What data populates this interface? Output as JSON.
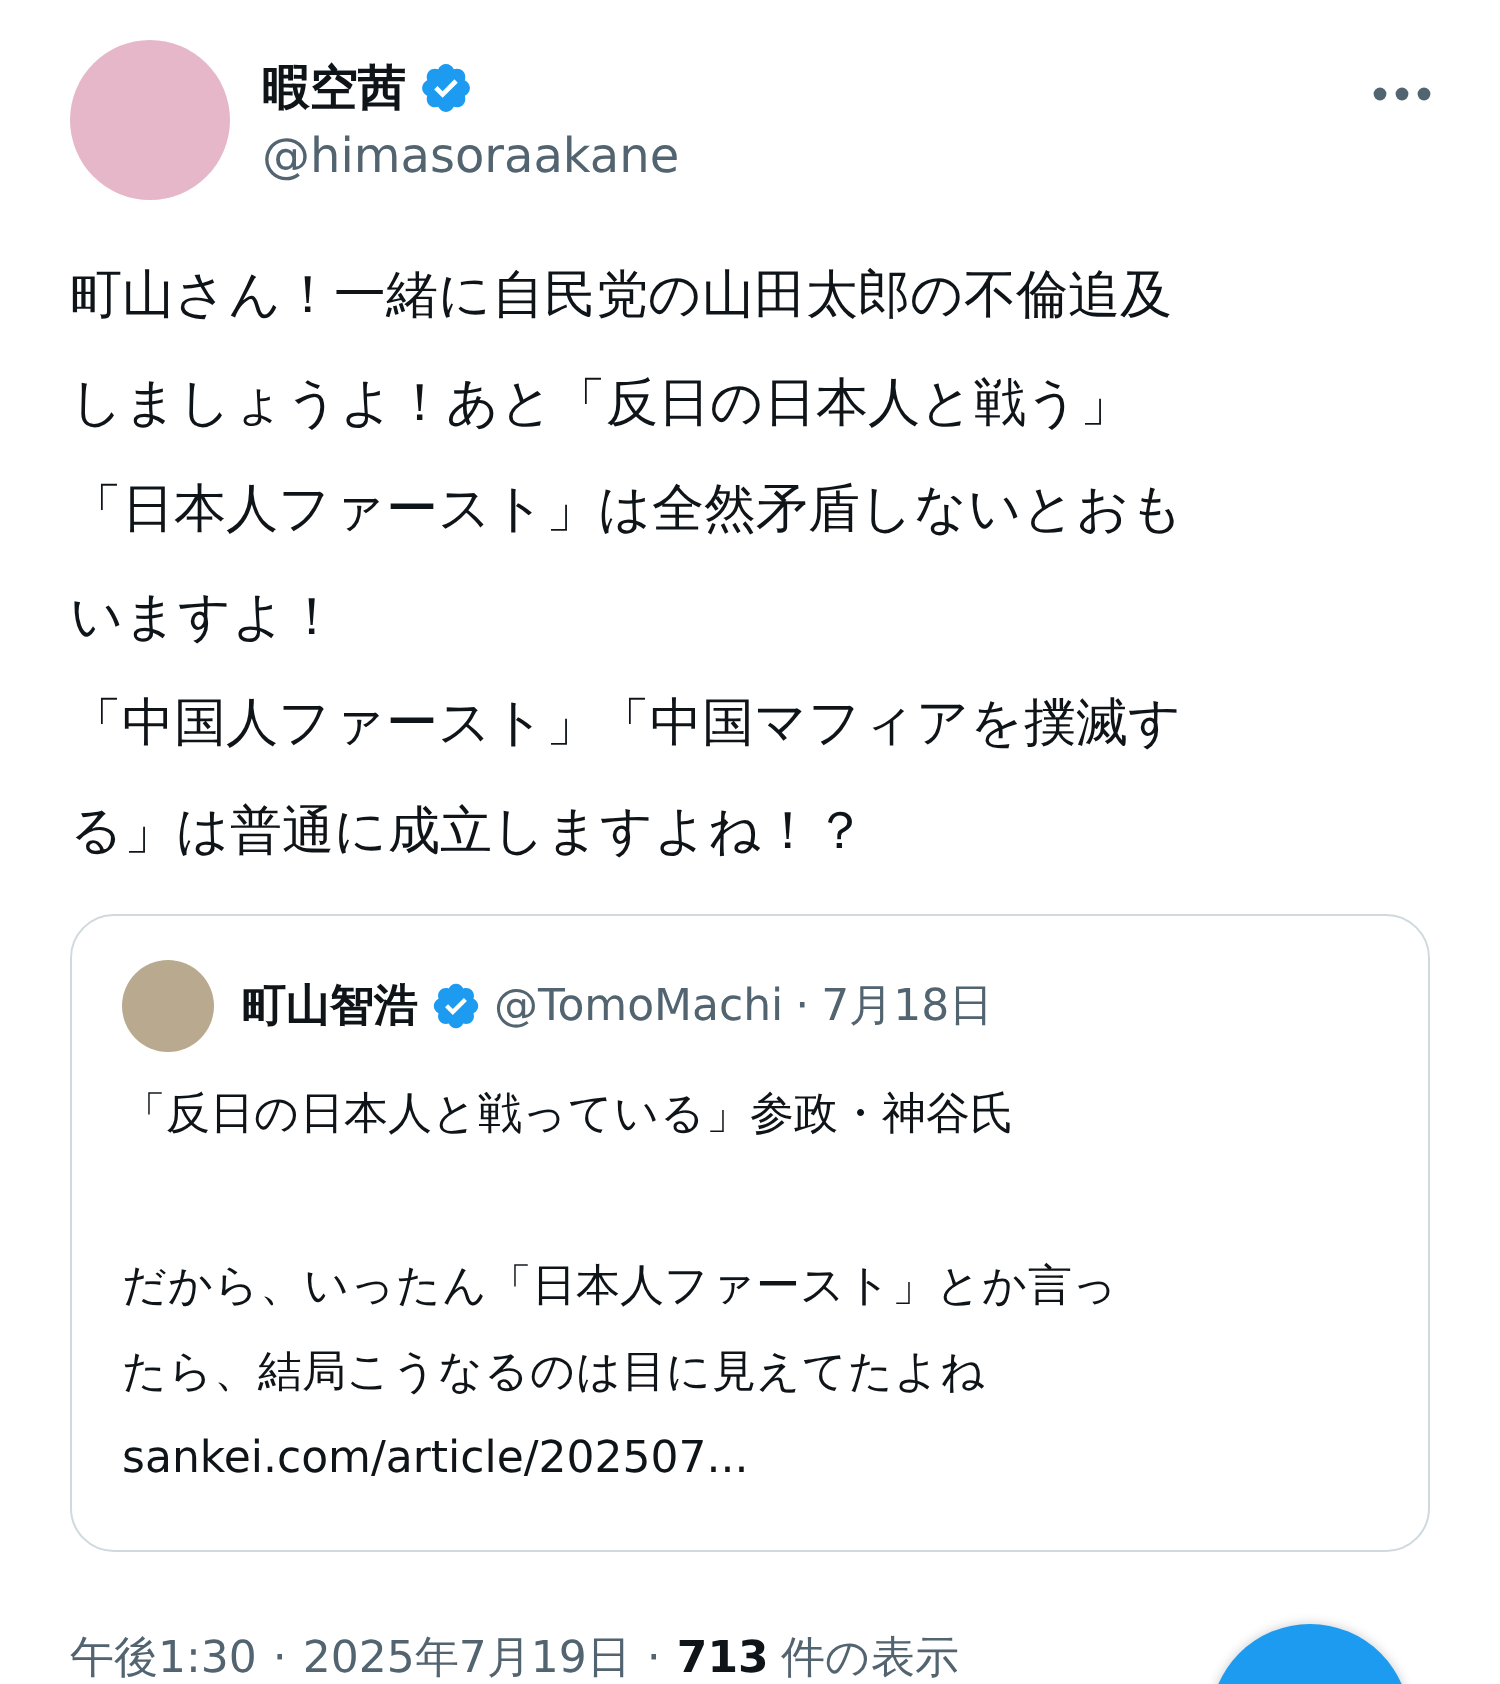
{
  "author": {
    "name": "暇空茜",
    "verified": true,
    "handle": "@himasoraakane"
  },
  "post": {
    "lines": [
      "町山さん！一緒に自民党の山田太郎の不倫追及",
      "しましょうよ！あと「反日の日本人と戦う」",
      "「日本人ファースト」は全然矛盾しないとおも",
      "いますよ！",
      "「中国人ファースト」「中国マフィアを撲滅す",
      "る」は普通に成立しますよね！？"
    ]
  },
  "quote": {
    "name": "町山智浩",
    "verified": true,
    "handle": "@TomoMachi",
    "separator": "·",
    "date": "7月18日",
    "paragraphs": [
      [
        "「反日の日本人と戦っている」参政・神谷氏"
      ],
      [
        "だから、いったん「日本人ファースト」とか言っ",
        "たら、結局こうなるのは目に見えてたよね",
        "sankei.com/article/202507..."
      ]
    ]
  },
  "meta": {
    "time": "午後1:30",
    "separator": "·",
    "date": "2025年7月19日",
    "views_count": "713",
    "views_label": "件の表示"
  }
}
